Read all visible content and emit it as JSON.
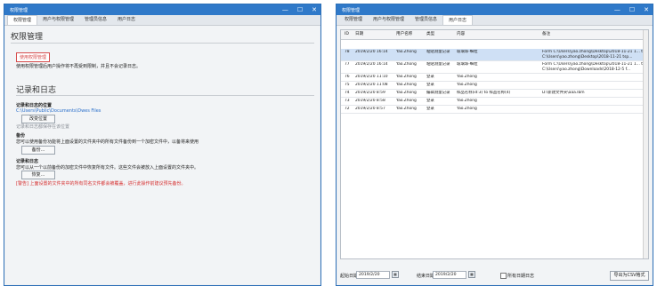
{
  "left": {
    "title": "权限管理",
    "controls": [
      "—",
      "☐",
      "✕"
    ],
    "tabs": [
      "权限管理",
      "用户与权限管理",
      "管理员信息",
      "用户日志"
    ],
    "permission_heading": "权限管理",
    "permission_button": "使用权限管理",
    "permission_desc": "使用权限管理后用户操作将不再受到限制，并且不会记录日志。",
    "record_heading": "记录和日志",
    "loc_label": "记录和日志的位置",
    "loc_path": "C:\\Users\\Public\\Documents\\Dwes Files",
    "change_button": "改变位置",
    "loc_hint": "记录和日志都保存在该位置",
    "backup_label": "备份",
    "backup_desc": "您可以使用备份功能将上面设置的文件夹中的所有文件备份到一个加密文件中，以备将来使用",
    "backup_button": "备份...",
    "restore_label": "记录和日志",
    "restore_desc": "您可以从一个以前备份的加密文件中恢复所有文件。这些文件会被放入上面设置的文件夹中。",
    "restore_button": "恢复...",
    "warning": "[警告] 上面设置的文件夹中的所有同名文件都会被覆盖，进行此操作前建议预先备份。"
  },
  "right": {
    "title": "权限管理",
    "controls": [
      "—",
      "☐",
      "✕"
    ],
    "tabs": [
      "权限管理",
      "用户与权限管理",
      "管理员信息",
      "用户日志"
    ],
    "columns": [
      "ID",
      "日期",
      "用户名称",
      "类型",
      "内容",
      "备注"
    ],
    "rows": [
      {
        "id": "78",
        "date": "2019/2/20 16:14",
        "user": "Yao.Zhong",
        "type": "粘贴测量记录",
        "content": "玻璃珠-细粒",
        "note": "Form C:\\Users\\yao.zhong\\Desktop\\2018-11-21 1... to C:\\Users\\yao.zhong\\Desktop\\2018-11-21 tsp...",
        "tall": true,
        "sel": true
      },
      {
        "id": "77",
        "date": "2019/2/20 16:14",
        "user": "Yao.Zhong",
        "type": "粘贴测量记录",
        "content": "玻璃珠-细粒",
        "note": "Form C:\\Users\\yao.zhong\\Desktop\\2018-11-21 1... to C:\\Users\\yao.zhong\\Downloads\\2018-12-5 f...",
        "tall": true,
        "sel": false
      },
      {
        "id": "76",
        "date": "2019/2/20 11:10",
        "user": "Yao.Zhong",
        "type": "登录",
        "content": "Yao.Zhong",
        "note": "",
        "tall": false,
        "sel": false
      },
      {
        "id": "75",
        "date": "2019/2/20 11:08",
        "user": "Yao.Zhong",
        "type": "登录",
        "content": "Yao.Zhong",
        "note": "",
        "tall": false,
        "sel": false
      },
      {
        "id": "74",
        "date": "2019/2/20 8:59",
        "user": "Yao.Zhong",
        "type": "编辑测量记录",
        "content": "样品名称(id:3) to 样品名称(4)",
        "note": "D:\\新建文件夹\\aaa.lbm",
        "tall": false,
        "sel": false
      },
      {
        "id": "73",
        "date": "2019/2/20 8:58",
        "user": "Yao.Zhong",
        "type": "登录",
        "content": "Yao.Zhong",
        "note": "",
        "tall": false,
        "sel": false
      },
      {
        "id": "72",
        "date": "2019/2/20 8:57",
        "user": "Yao.Zhong",
        "type": "登录",
        "content": "Yao.Zhong",
        "note": "",
        "tall": false,
        "sel": false
      }
    ],
    "start_label": "起始日期",
    "start_value": "2019/2/20",
    "end_label": "结束日期",
    "end_value": "2019/2/20",
    "all_label": "所有日期日志",
    "export_button": "导出为CSV格式"
  }
}
